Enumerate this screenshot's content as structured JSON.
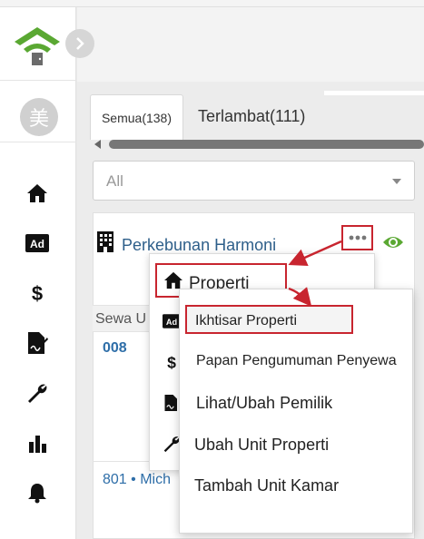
{
  "sidebar": {
    "avatar_text": "美",
    "icons": [
      "home-icon",
      "ad-icon",
      "dollar-icon",
      "contract-icon",
      "wrench-icon",
      "bar-chart-icon",
      "bell-icon"
    ]
  },
  "tabs": [
    {
      "label": "Semua(138)",
      "active": true
    },
    {
      "label": "Terlambat(111)",
      "active": false
    }
  ],
  "filter": {
    "selected": "All"
  },
  "property": {
    "name": "Perkebunan Harmoni",
    "sewa_label": "Sewa U",
    "units": [
      {
        "number": "008"
      },
      {
        "number": "801 • Mich"
      }
    ]
  },
  "menu1": {
    "title": "Properti",
    "icons": [
      "ad-icon",
      "dollar-icon",
      "contract-icon",
      "wrench-icon"
    ]
  },
  "menu2": {
    "items": [
      "Ikhtisar Properti",
      "Papan Pengumuman Penyewa",
      "Lihat/Ubah Pemilik",
      "Ubah Unit Properti",
      "Tambah Unit Kamar"
    ]
  },
  "colors": {
    "accent_green": "#5aa832",
    "link_blue": "#2e5f8a",
    "annotation_red": "#c8252f"
  }
}
